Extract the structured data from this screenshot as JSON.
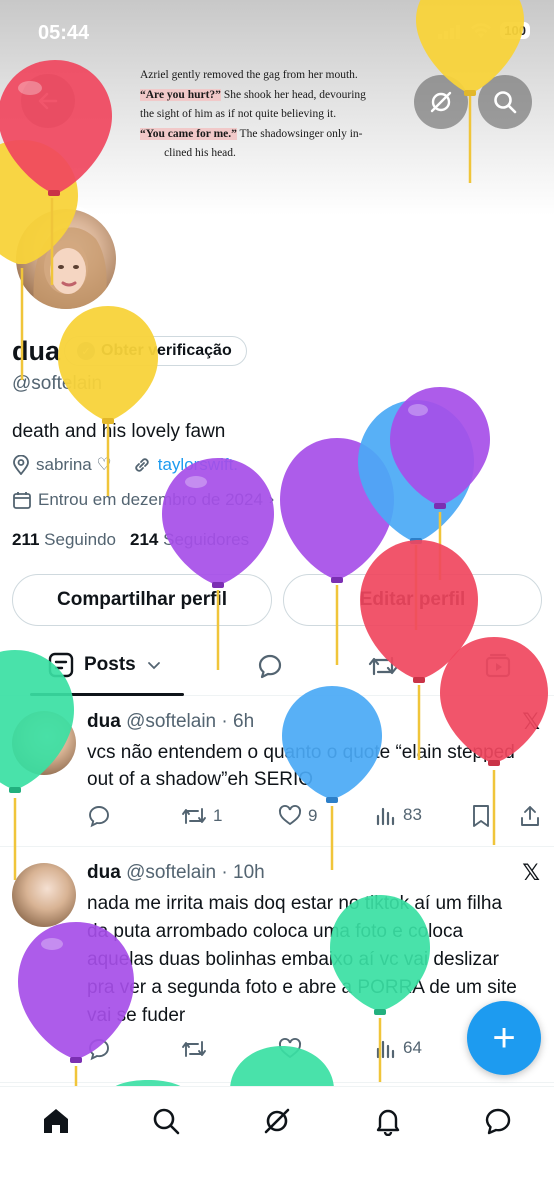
{
  "status_bar": {
    "time": "05:44",
    "battery": "100"
  },
  "banner": {
    "lines": [
      {
        "pre": "Azriel gently removed the gag from her mouth.",
        "hl": "",
        "post": ""
      },
      {
        "pre": "",
        "hl": "“Are you hurt?”",
        "post": " She shook her head, devouring"
      },
      {
        "pre": "the sight of him as if not quite believing it.",
        "hl": "",
        "post": ""
      },
      {
        "pre": "",
        "hl": "“You came for me.”",
        "post": " The shadowsinger only in-"
      },
      {
        "pre": "clined his head.",
        "hl": "",
        "post": ""
      }
    ]
  },
  "profile": {
    "name": "dua",
    "verify_label": "Obter verificação",
    "handle": "@softelain",
    "bio": "death and his lovely fawn",
    "location": "sabrina ♡",
    "link": "taylorswift.",
    "joined": "Entrou em dezembro de 2024",
    "following_count": "211",
    "following_label": "Seguindo",
    "followers_count": "214",
    "followers_label": "Seguidores"
  },
  "actions": {
    "share": "Compartilhar perfil",
    "edit": "Editar perfil"
  },
  "tabs": {
    "posts": "Posts"
  },
  "tweets": [
    {
      "name": "dua",
      "handle": "@softelain",
      "time": "· 6h",
      "text": "vcs não entendem o quanto o quote “elain stepped out of a shadow”eh SERIO",
      "retweets": "1",
      "likes": "9",
      "views": "83"
    },
    {
      "name": "dua",
      "handle": "@softelain",
      "time": "· 10h",
      "text": "nada me irrita mais doq estar no tiktok aí um filha da puta arrombado coloca uma foto e coloca aquelas duas bolinhas embaixo aí vc vai deslizar pra ver a segunda foto e abre a PORRA de um site vai se fuder",
      "retweets": "",
      "likes": "",
      "views": "64"
    }
  ],
  "colors": {
    "accent": "#1d9bf0",
    "text": "#0f1419",
    "muted": "#536471",
    "red": "#f0475e",
    "yellow": "#f8d33a",
    "purple": "#a64ee8",
    "blue": "#4aa9f5",
    "green": "#39dfa3"
  },
  "icons": [
    "back-arrow-icon",
    "grok-icon",
    "search-icon",
    "location-icon",
    "link-icon",
    "calendar-icon",
    "chevron-right-icon",
    "posts-icon",
    "chevron-down-icon",
    "reply-icon",
    "repost-icon",
    "media-icon",
    "like-icon",
    "views-icon",
    "bookmark-icon",
    "share-icon",
    "x-logo-icon",
    "compose-icon",
    "home-icon",
    "notifications-icon",
    "messages-icon"
  ]
}
